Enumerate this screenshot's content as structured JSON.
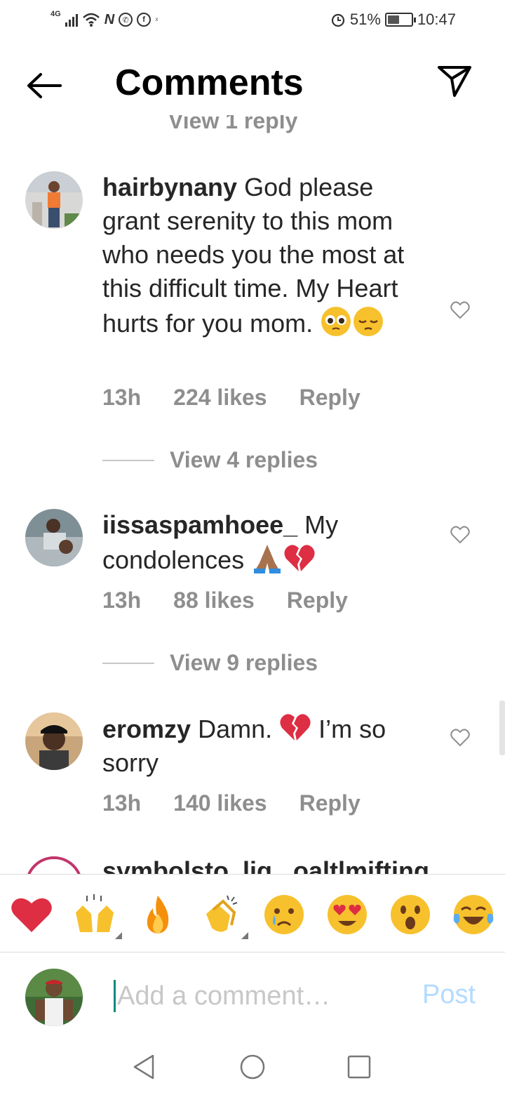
{
  "status_bar": {
    "network": "4G",
    "battery": "51%",
    "battery_level": 0.51,
    "time": "10:47"
  },
  "header": {
    "title": "Comments",
    "back_icon": "back-arrow-icon",
    "share_icon": "send-icon"
  },
  "cut_off_top_text": "View 1 reply",
  "comments": [
    {
      "username": "hairbynany",
      "text": "God please grant serenity to this mom who needs you the most at this difficult time. My Heart hurts for you mom.",
      "emojis": [
        "pleading-face-emoji",
        "pensive-face-emoji"
      ],
      "time": "13h",
      "likes": "224 likes",
      "reply": "Reply",
      "view_replies": "View 4 replies"
    },
    {
      "username": "iissaspamhoee_",
      "text": "My condolences",
      "emojis": [
        "folded-hands-emoji",
        "broken-heart-emoji"
      ],
      "time": "13h",
      "likes": "88 likes",
      "reply": "Reply",
      "view_replies": "View 9 replies"
    },
    {
      "username": "eromzy",
      "text_before": "Damn.",
      "text_after": "I’m so sorry",
      "emojis": [
        "broken-heart-emoji"
      ],
      "time": "13h",
      "likes": "140 likes",
      "reply": "Reply"
    }
  ],
  "cut_off_bottom_text": "symbolsto..lig ..oaltlmifting",
  "emoji_bar": [
    "red-heart",
    "raising-hands",
    "fire",
    "clapping-hands",
    "crying-face",
    "heart-eyes",
    "astonished-face",
    "tears-of-joy"
  ],
  "composer": {
    "placeholder": "Add a comment…",
    "post_label": "Post"
  },
  "colors": {
    "post_disabled": "#b3dbff",
    "muted_text": "#8e8e8e",
    "cursor": "#0a8a80"
  }
}
